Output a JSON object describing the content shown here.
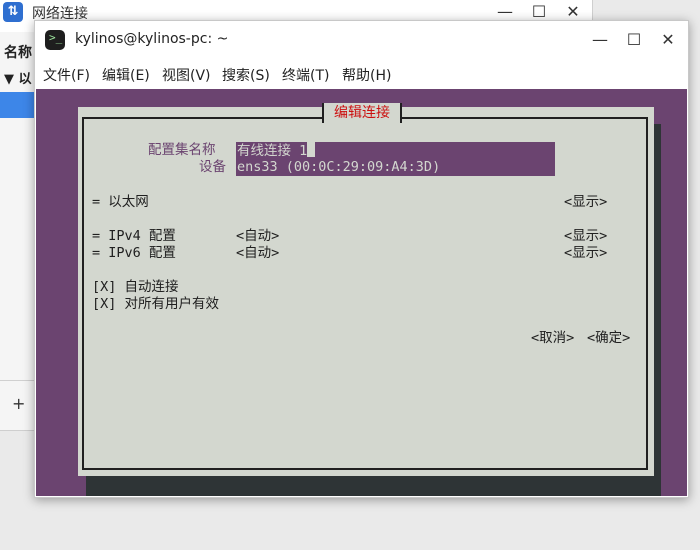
{
  "bg_window": {
    "title": "网络连接",
    "column_header": "名称",
    "group_label": "以",
    "group_arrow": "▼",
    "add_label": "+",
    "minimize": "—",
    "maximize": "☐",
    "close": "✕"
  },
  "terminal": {
    "title": "kylinos@kylinos-pc: ~",
    "icon_glyph": ">_",
    "minimize": "—",
    "maximize": "☐",
    "close": "✕",
    "menu": [
      "文件(F)",
      "编辑(E)",
      "视图(V)",
      "搜索(S)",
      "终端(T)",
      "帮助(H)"
    ]
  },
  "dialog": {
    "title": "编辑连接",
    "profile_name_label": "配置集名称",
    "profile_name_value": "有线连接 1",
    "device_label": "设备",
    "device_value": "ens33 (00:0C:29:09:A4:3D)",
    "ethernet_label": "= 以太网",
    "ethernet_show": "<显示>",
    "ipv4_label": "= IPv4 配置",
    "ipv4_mode": "<自动>",
    "ipv4_show": "<显示>",
    "ipv6_label": "= IPv6 配置",
    "ipv6_mode": "<自动>",
    "ipv6_show": "<显示>",
    "autoconnect": "[X] 自动连接",
    "all_users": "[X] 对所有用户有效",
    "cancel": "<取消>",
    "ok": "<确定>"
  }
}
